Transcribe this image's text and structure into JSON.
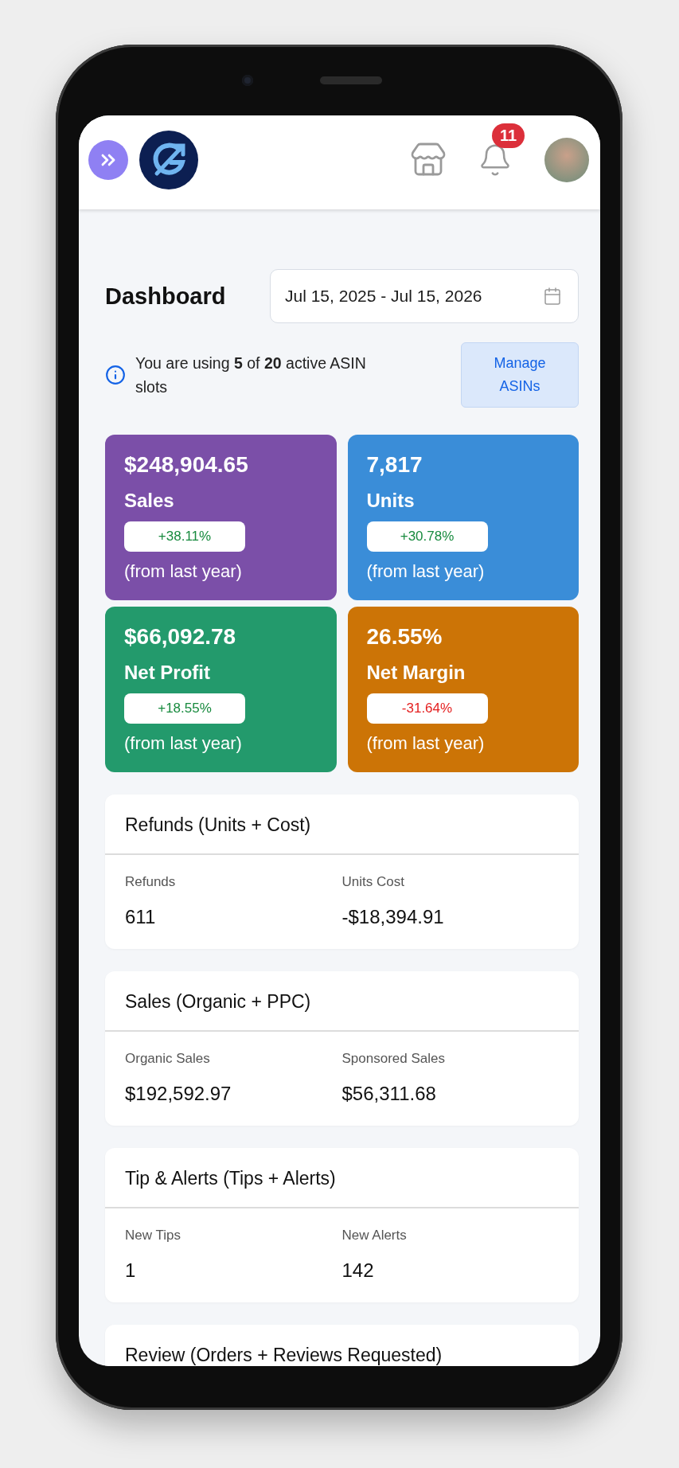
{
  "header": {
    "notification_count": "11"
  },
  "page_title": "Dashboard",
  "date_range": {
    "value": "Jul 15, 2025 - Jul 15, 2026"
  },
  "asin_notice": {
    "text": "You are using **5** of **20** active ASIN slots",
    "button": "Manage ASINs"
  },
  "kpi_cards": [
    {
      "value": "$248,904.65",
      "label": "Sales",
      "change": "+38.11%",
      "negative": false,
      "note": "(from last year)",
      "color": "#7b4fa8"
    },
    {
      "value": "7,817",
      "label": "Units",
      "change": "+30.78%",
      "negative": false,
      "note": "(from last year)",
      "color": "#3a8dd8"
    },
    {
      "value": "$66,092.78",
      "label": "Net Profit",
      "change": "+18.55%",
      "negative": false,
      "note": "(from last year)",
      "color": "#239a6c"
    },
    {
      "value": "26.55%",
      "label": "Net Margin",
      "change": "-31.64%",
      "negative": true,
      "note": "(from last year)",
      "color": "#cc7406"
    }
  ],
  "sections": [
    {
      "title": "Refunds (Units + Cost)",
      "metrics": [
        {
          "label": "Refunds",
          "value": "611"
        },
        {
          "label": "Units Cost",
          "value": "-$18,394.91"
        }
      ]
    },
    {
      "title": "Sales (Organic + PPC)",
      "metrics": [
        {
          "label": "Organic Sales",
          "value": "$192,592.97"
        },
        {
          "label": "Sponsored Sales",
          "value": "$56,311.68"
        }
      ]
    },
    {
      "title": "Tip & Alerts (Tips + Alerts)",
      "metrics": [
        {
          "label": "New Tips",
          "value": "1"
        },
        {
          "label": "New Alerts",
          "value": "142"
        }
      ]
    },
    {
      "title": "Review (Orders + Reviews Requested)"
    }
  ]
}
